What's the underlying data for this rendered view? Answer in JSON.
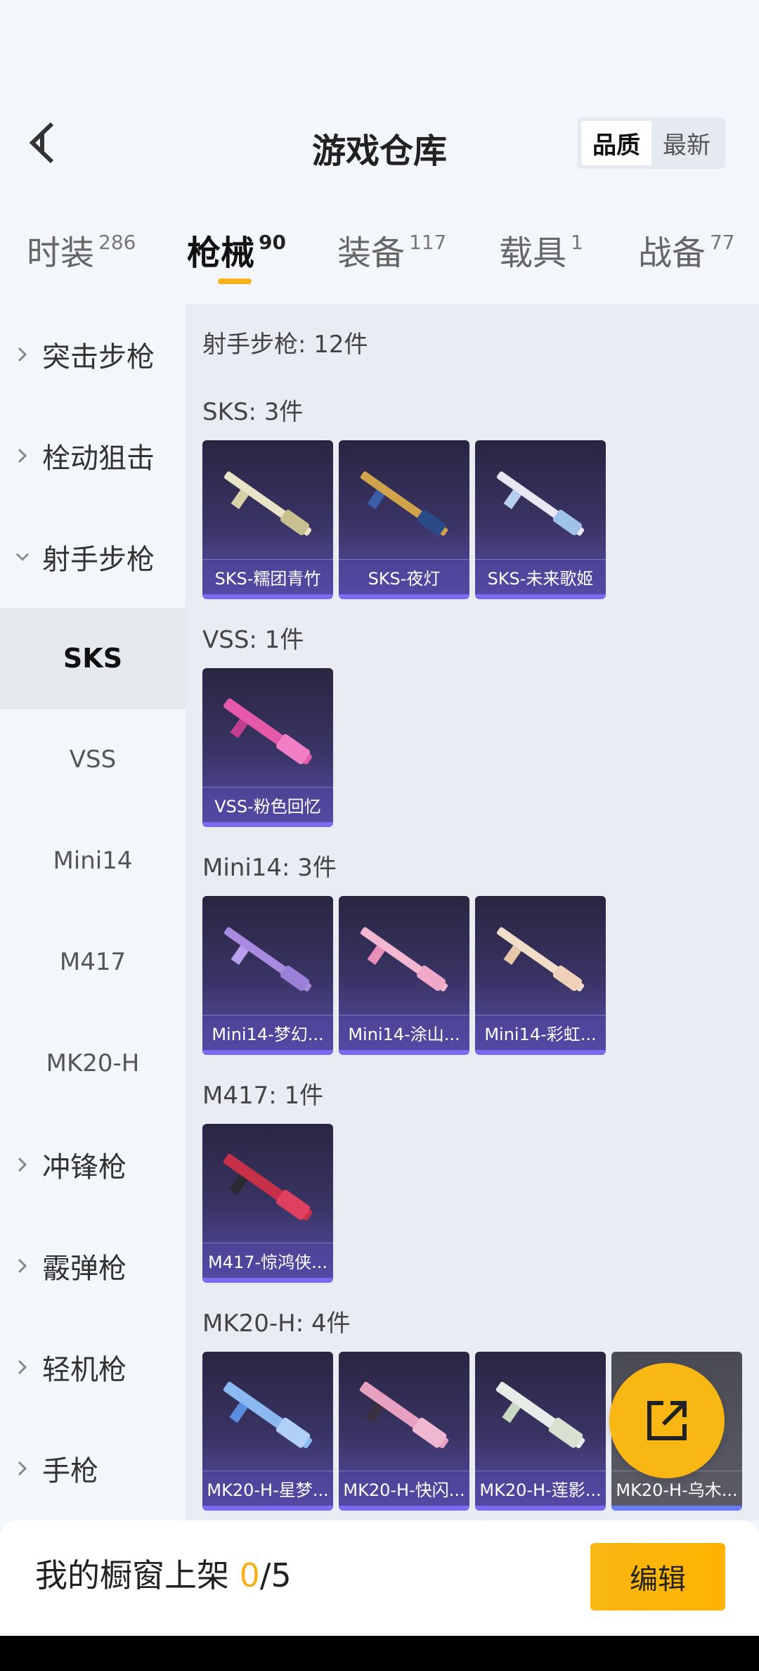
{
  "header": {
    "title": "游戏仓库",
    "sort_options": [
      "品质",
      "最新"
    ],
    "sort_selected": "品质"
  },
  "tabs": [
    {
      "label": "时装",
      "count": "286"
    },
    {
      "label": "枪械",
      "count": "90",
      "active": true
    },
    {
      "label": "装备",
      "count": "117"
    },
    {
      "label": "载具",
      "count": "1"
    },
    {
      "label": "战备",
      "count": "77"
    }
  ],
  "sidebar": {
    "items": [
      {
        "label": "突击步枪",
        "type": "category"
      },
      {
        "label": "栓动狙击",
        "type": "category"
      },
      {
        "label": "射手步枪",
        "type": "category",
        "expanded": true
      },
      {
        "label": "SKS",
        "type": "sub",
        "selected": true
      },
      {
        "label": "VSS",
        "type": "sub"
      },
      {
        "label": "Mini14",
        "type": "sub"
      },
      {
        "label": "M417",
        "type": "sub"
      },
      {
        "label": "MK20-H",
        "type": "sub"
      },
      {
        "label": "冲锋枪",
        "type": "category"
      },
      {
        "label": "霰弹枪",
        "type": "category"
      },
      {
        "label": "轻机枪",
        "type": "category"
      },
      {
        "label": "手枪",
        "type": "category"
      }
    ]
  },
  "content": {
    "heading": "射手步枪: 12件",
    "sections": [
      {
        "title": "SKS: 3件",
        "items": [
          "SKS-糯团青竹",
          "SKS-夜灯",
          "SKS-未来歌姬"
        ]
      },
      {
        "title": "VSS: 1件",
        "items": [
          "VSS-粉色回忆"
        ]
      },
      {
        "title": "Mini14: 3件",
        "items": [
          "Mini14-梦幻...",
          "Mini14-涂山...",
          "Mini14-彩虹..."
        ]
      },
      {
        "title": "M417: 1件",
        "items": [
          "M417-惊鸿侠..."
        ]
      },
      {
        "title": "MK20-H: 4件",
        "items": [
          "MK20-H-星梦...",
          "MK20-H-快闪...",
          "MK20-H-莲影...",
          "MK20-H-乌木..."
        ]
      }
    ]
  },
  "bottom": {
    "shelf_prefix": "我的橱窗上架 ",
    "shelf_count": "0",
    "shelf_total": "/5",
    "edit_label": "编辑"
  },
  "colors": {
    "accent": "#f7b21b",
    "card_bottom": "#7a6cf0"
  },
  "icons": {
    "back": "chevron-left-icon",
    "fab": "share-external-icon"
  }
}
